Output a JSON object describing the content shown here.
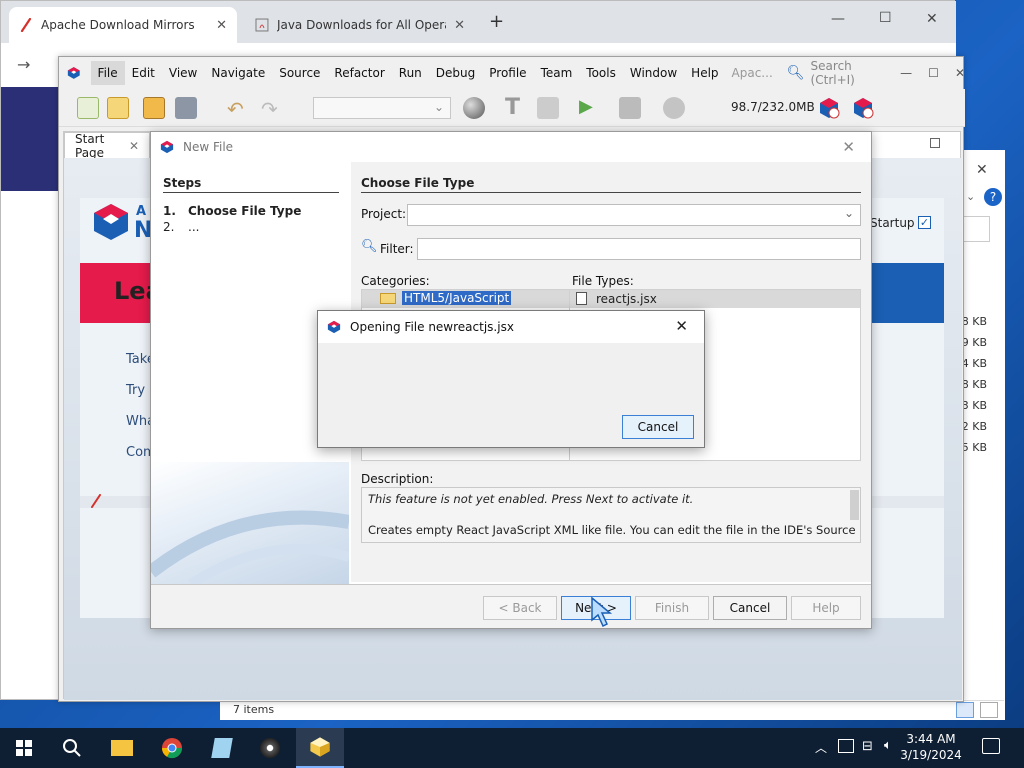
{
  "chrome": {
    "tabs": [
      {
        "title": "Apache Download Mirrors"
      },
      {
        "title": "Java Downloads for All Operati"
      }
    ],
    "new_tab": "+",
    "min": "—",
    "max": "☐",
    "close": "✕"
  },
  "explorer": {
    "sizes": [
      "8 KB",
      "9 KB",
      "4 KB",
      "8 KB",
      "3 KB",
      "2 KB",
      "5 KB"
    ],
    "status": "7 items"
  },
  "ide": {
    "menu": [
      "File",
      "Edit",
      "View",
      "Navigate",
      "Source",
      "Refactor",
      "Run",
      "Debug",
      "Profile",
      "Team",
      "Tools",
      "Window",
      "Help"
    ],
    "title_fragment": "Apac...",
    "search_placeholder": "Search (Ctrl+I)",
    "memory": "98.7/232.0MB",
    "start_tab": "Start Page",
    "startup_label": "Startup",
    "links": [
      "Take",
      "Try a",
      "Wha",
      "Com"
    ],
    "banner_fragment": "Lea",
    "logo_fragment_a": "A",
    "logo_fragment_n": "N"
  },
  "new_file": {
    "title": "New File",
    "steps_heading": "Steps",
    "steps": [
      {
        "num": "1.",
        "label": "Choose File Type"
      },
      {
        "num": "2.",
        "label": "..."
      }
    ],
    "main_heading": "Choose File Type",
    "project_label": "Project:",
    "project_value": "",
    "filter_label": "Filter:",
    "filter_value": "",
    "categories_label": "Categories:",
    "categories": [
      "HTML5/JavaScript"
    ],
    "file_types_label": "File Types:",
    "file_types": [
      "reactjs.jsx"
    ],
    "description_label": "Description:",
    "description_line1": "This feature is not yet enabled. Press Next to activate it.",
    "description_line2": "Creates empty React JavaScript XML like file. You can edit the file in the IDE's Source",
    "buttons": {
      "back": "< Back",
      "next": "Next >",
      "finish": "Finish",
      "cancel": "Cancel",
      "help": "Help"
    }
  },
  "opening": {
    "title": "Opening File newreactjs.jsx",
    "cancel": "Cancel"
  },
  "taskbar": {
    "time": "3:44 AM",
    "date": "3/19/2024"
  },
  "colors": {
    "netbeans_red": "#e41b4b",
    "netbeans_blue": "#1a5fb4",
    "taskbar": "#0f1f33"
  }
}
